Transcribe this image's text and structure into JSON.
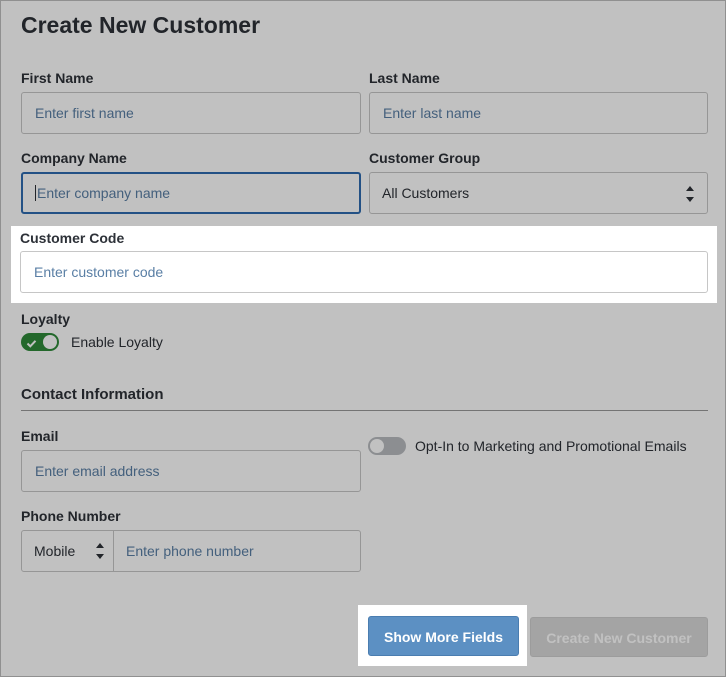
{
  "form": {
    "title": "Create New Customer",
    "first_name": {
      "label": "First Name",
      "placeholder": "Enter first name"
    },
    "last_name": {
      "label": "Last Name",
      "placeholder": "Enter last name"
    },
    "company_name": {
      "label": "Company Name",
      "placeholder": "Enter company name"
    },
    "customer_group": {
      "label": "Customer Group",
      "value": "All Customers"
    },
    "customer_code": {
      "label": "Customer Code",
      "placeholder": "Enter customer code"
    },
    "loyalty": {
      "label": "Loyalty",
      "toggle_label": "Enable Loyalty",
      "enabled": true
    }
  },
  "contact": {
    "section_title": "Contact Information",
    "email": {
      "label": "Email",
      "placeholder": "Enter email address"
    },
    "marketing_opt_in": {
      "label": "Opt-In to Marketing and Promotional Emails",
      "enabled": false
    },
    "phone": {
      "label": "Phone Number",
      "type_value": "Mobile",
      "placeholder": "Enter phone number"
    }
  },
  "actions": {
    "show_more_label": "Show More Fields",
    "create_label": "Create New Customer"
  },
  "colors": {
    "accent": "#5c90c3",
    "toggle_on": "#2f8a3a",
    "focus_border": "#2f6bb0"
  }
}
